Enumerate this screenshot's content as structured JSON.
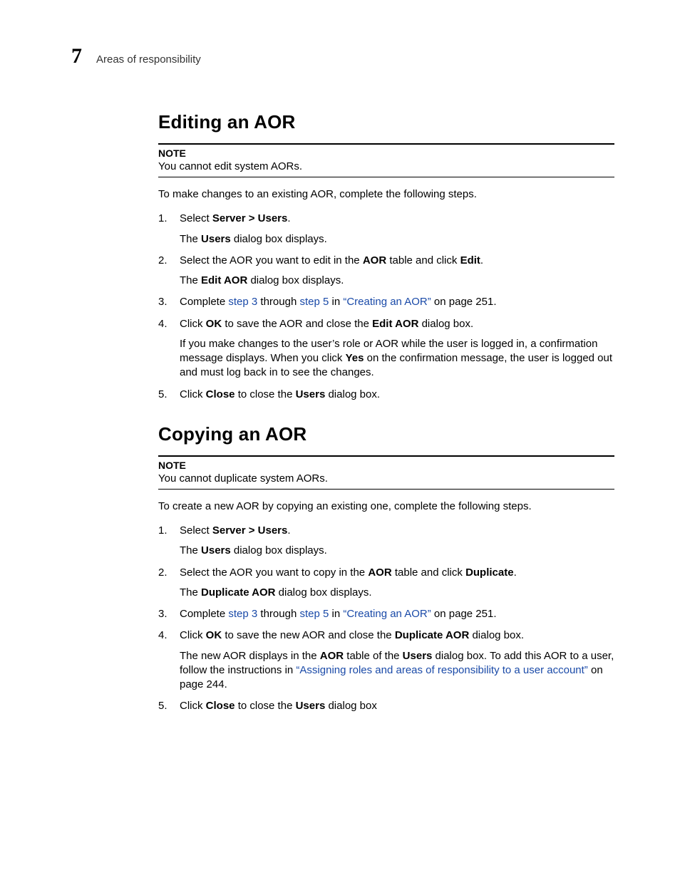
{
  "chapter_number": "7",
  "running_title": "Areas of responsibility",
  "section1": {
    "heading": "Editing an AOR",
    "note_label": "NOTE",
    "note_text": "You cannot edit system AORs.",
    "intro": "To make changes to an existing AOR, complete the following steps.",
    "step1_pre": "Select ",
    "step1_b": "Server > Users",
    "step1_post": ".",
    "step1_sub_pre": "The ",
    "step1_sub_b": "Users",
    "step1_sub_post": " dialog box displays.",
    "step2_pre": "Select the AOR you want to edit in the ",
    "step2_b1": "AOR",
    "step2_mid": " table and click ",
    "step2_b2": "Edit",
    "step2_post": ".",
    "step2_sub_pre": "The ",
    "step2_sub_b": "Edit AOR",
    "step2_sub_post": " dialog box displays.",
    "step3_pre": "Complete ",
    "step3_l1": "step 3",
    "step3_mid1": " through ",
    "step3_l2": "step 5",
    "step3_mid2": " in ",
    "step3_l3": "“Creating an AOR”",
    "step3_post": " on page 251.",
    "step4_pre": "Click ",
    "step4_b1": "OK",
    "step4_mid": " to save the AOR and close the ",
    "step4_b2": "Edit AOR",
    "step4_post": " dialog box.",
    "step4_sub_pre": "If you make changes to the user’s role or AOR while the user is logged in, a confirmation message displays. When you click ",
    "step4_sub_b": "Yes",
    "step4_sub_post": " on the confirmation message, the user is logged out and must log back in to see the changes.",
    "step5_pre": "Click ",
    "step5_b1": "Close",
    "step5_mid": " to close the ",
    "step5_b2": "Users",
    "step5_post": " dialog box."
  },
  "section2": {
    "heading": "Copying an AOR",
    "note_label": "NOTE",
    "note_text": "You cannot duplicate system AORs.",
    "intro": "To create a new AOR by copying an existing one, complete the following steps.",
    "step1_pre": "Select ",
    "step1_b": "Server > Users",
    "step1_post": ".",
    "step1_sub_pre": "The ",
    "step1_sub_b": "Users",
    "step1_sub_post": " dialog box displays.",
    "step2_pre": "Select the AOR you want to copy in the ",
    "step2_b1": "AOR",
    "step2_mid": " table and click ",
    "step2_b2": "Duplicate",
    "step2_post": ".",
    "step2_sub_pre": "The ",
    "step2_sub_b": "Duplicate AOR",
    "step2_sub_post": " dialog box displays.",
    "step3_pre": "Complete ",
    "step3_l1": "step 3",
    "step3_mid1": " through ",
    "step3_l2": "step 5",
    "step3_mid2": " in ",
    "step3_l3": "“Creating an AOR”",
    "step3_post": " on page 251.",
    "step4_pre": "Click ",
    "step4_b1": "OK",
    "step4_mid": " to save the new AOR and close the ",
    "step4_b2": "Duplicate AOR",
    "step4_post": " dialog box.",
    "step4_sub_pre": "The new AOR displays in the ",
    "step4_sub_b1": "AOR",
    "step4_sub_mid1": " table of the ",
    "step4_sub_b2": "Users",
    "step4_sub_mid2": " dialog box. To add this AOR to a user, follow the instructions in ",
    "step4_sub_l": "“Assigning roles and areas of responsibility to a user account”",
    "step4_sub_post": " on page 244.",
    "step5_pre": "Click ",
    "step5_b1": "Close",
    "step5_mid": " to close the ",
    "step5_b2": "Users",
    "step5_post": " dialog box"
  }
}
